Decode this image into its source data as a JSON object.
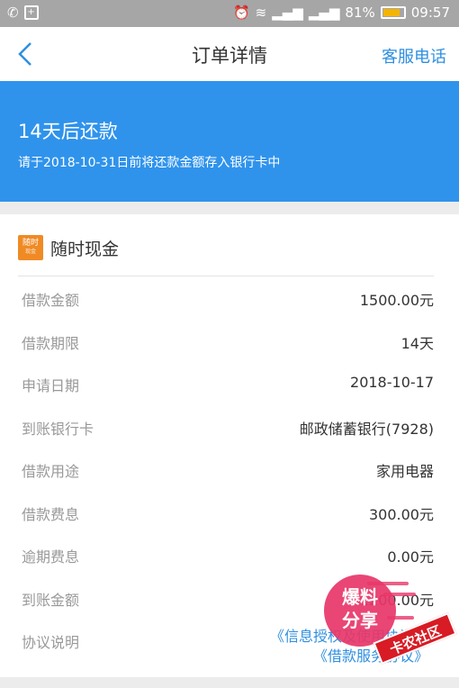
{
  "status_bar": {
    "battery": "81%",
    "battery_level": 0.81,
    "time": "09:57"
  },
  "navbar": {
    "title": "订单详情",
    "action_label": "客服电话"
  },
  "banner": {
    "title": "14天后还款",
    "subtitle": "请于2018-10-31日前将还款金额存入银行卡中"
  },
  "brand": {
    "logo_text": "随时",
    "logo_subtext": "现金",
    "name": "随时现金"
  },
  "details": [
    {
      "label": "借款金额",
      "value": "1500.00元"
    },
    {
      "label": "借款期限",
      "value": "14天"
    },
    {
      "label": "申请日期",
      "value": "2018-10-17"
    },
    {
      "label": "到账银行卡",
      "value": "邮政储蓄银行(7928)"
    },
    {
      "label": "借款用途",
      "value": "家用电器"
    },
    {
      "label": "借款费息",
      "value": "300.00元"
    },
    {
      "label": "逾期费息",
      "value": "0.00元"
    },
    {
      "label": "到账金额",
      "value": "1200.00元"
    }
  ],
  "agreement": {
    "label": "协议说明",
    "link_1": "《信息授权及使用协议》",
    "link_2": "《借款服务协议》"
  },
  "watermark": {
    "line_1": "爆料",
    "line_2": "分享",
    "tag": "卡农社区"
  },
  "colors": {
    "accent": "#2f93ec",
    "link": "#2e8fe0",
    "brand": "#f08a24"
  }
}
